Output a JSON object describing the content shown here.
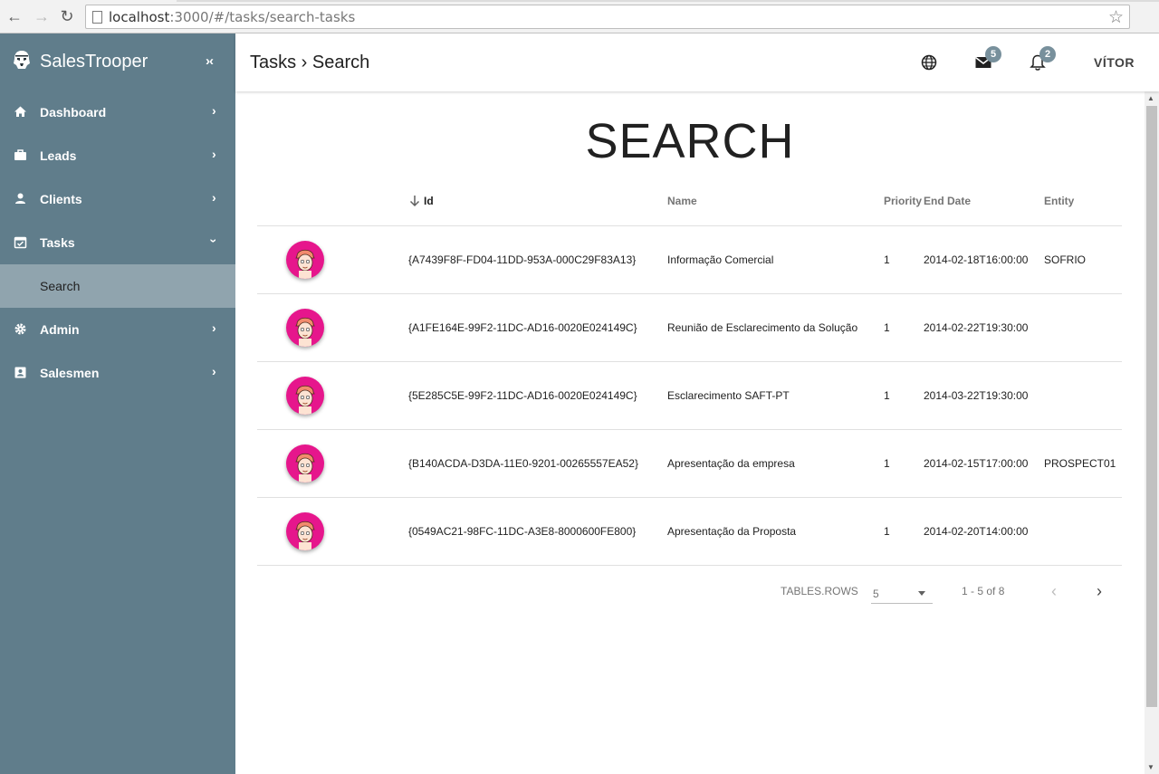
{
  "browser": {
    "url_host": "localhost",
    "url_rest": ":3000/#/tasks/search-tasks"
  },
  "sidebar": {
    "brand": "SalesTrooper",
    "collapse_label": "›‹",
    "items": [
      {
        "label": "Dashboard",
        "icon": "home-icon"
      },
      {
        "label": "Leads",
        "icon": "briefcase-icon"
      },
      {
        "label": "Clients",
        "icon": "person-icon"
      },
      {
        "label": "Tasks",
        "icon": "calendar-check-icon"
      },
      {
        "label": "Search",
        "icon": ""
      },
      {
        "label": "Admin",
        "icon": "gear-icon"
      },
      {
        "label": "Salesmen",
        "icon": "contact-card-icon"
      }
    ]
  },
  "header": {
    "breadcrumb": "Tasks › Search",
    "mail_count": "5",
    "notif_count": "2",
    "user": "VÍTOR"
  },
  "main": {
    "title": "SEARCH",
    "columns": [
      "Id",
      "Name",
      "Priority",
      "End Date",
      "Entity"
    ],
    "rows": [
      {
        "id": "{A7439F8F-FD04-11DD-953A-000C29F83A13}",
        "name": "Informação Comercial",
        "priority": "1",
        "end_date": "2014-02-18T16:00:00",
        "entity": "SOFRIO"
      },
      {
        "id": "{A1FE164E-99F2-11DC-AD16-0020E024149C}",
        "name": "Reunião de Esclarecimento da Solução",
        "priority": "1",
        "end_date": "2014-02-22T19:30:00",
        "entity": ""
      },
      {
        "id": "{5E285C5E-99F2-11DC-AD16-0020E024149C}",
        "name": "Esclarecimento SAFT-PT",
        "priority": "1",
        "end_date": "2014-03-22T19:30:00",
        "entity": ""
      },
      {
        "id": "{B140ACDA-D3DA-11E0-9201-00265557EA52}",
        "name": "Apresentação da empresa",
        "priority": "1",
        "end_date": "2014-02-15T17:00:00",
        "entity": "PROSPECT01"
      },
      {
        "id": "{0549AC21-98FC-11DC-A3E8-8000600FE800}",
        "name": "Apresentação da Proposta",
        "priority": "1",
        "end_date": "2014-02-20T14:00:00",
        "entity": ""
      }
    ],
    "footer": {
      "rows_label": "TABLES.ROWS",
      "rows_value": "5",
      "range": "1 - 5 of 8"
    }
  },
  "colors": {
    "sidebar": "#607d8b",
    "sidebar_active": "#90a4ae",
    "avatar": "#e6168c",
    "badge": "#78909c"
  }
}
